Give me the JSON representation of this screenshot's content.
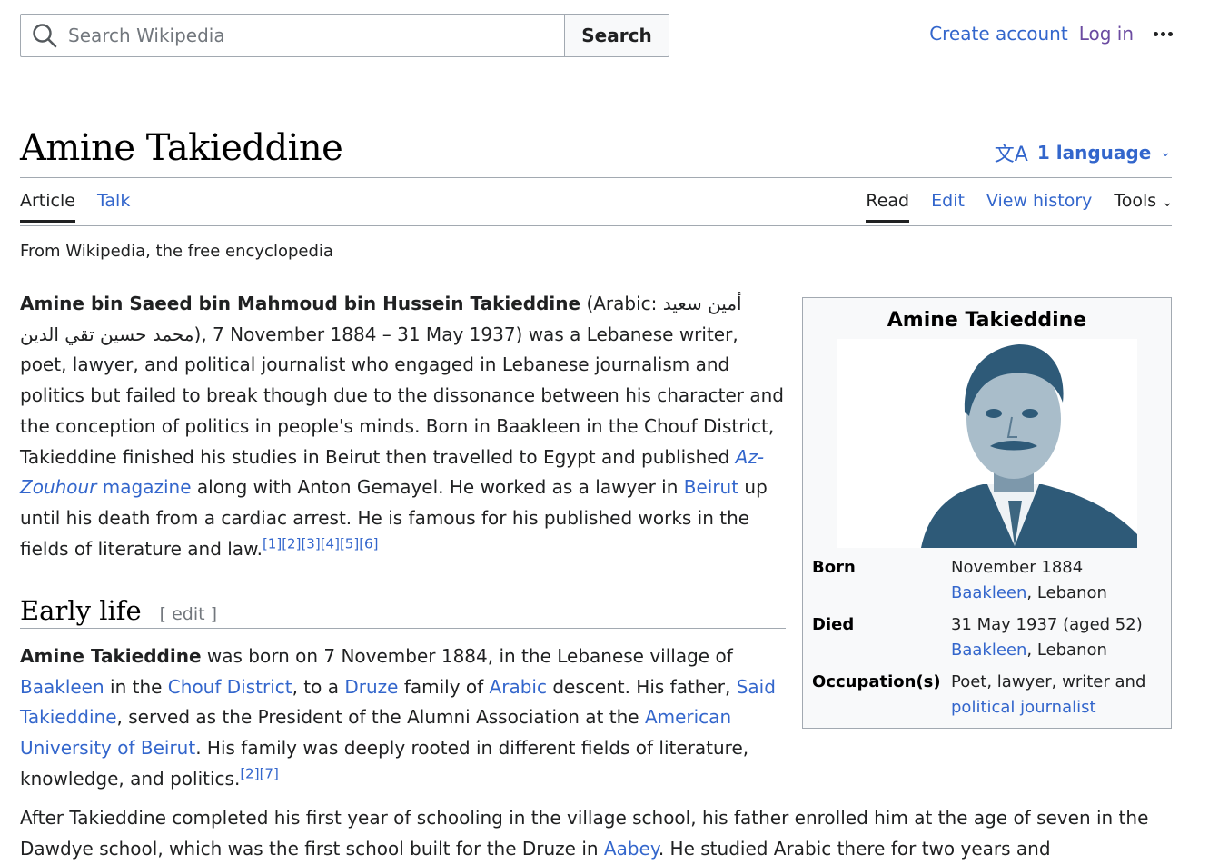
{
  "search": {
    "placeholder": "Search Wikipedia",
    "button": "Search"
  },
  "user_links": {
    "create_account": "Create account",
    "log_in": "Log in"
  },
  "page": {
    "title": "Amine Takieddine",
    "language_button": "1 language",
    "tagline": "From Wikipedia, the free encyclopedia"
  },
  "tabs": {
    "left": [
      "Article",
      "Talk"
    ],
    "right": [
      "Read",
      "Edit",
      "View history",
      "Tools"
    ]
  },
  "intro": {
    "bold_name": "Amine bin Saeed bin Mahmoud bin Hussein Takieddine",
    "arabic_prefix": " (Arabic: ",
    "arabic_name": "أمين سعيد محمد حسين تقي الدين",
    "text1": "), 7 November 1884 – 31 May 1937) was a Lebanese writer, poet, lawyer, and political journalist who engaged in Lebanese journalism and politics but failed to break though due to the dissonance between his character and the conception of politics in people's minds. Born in Baakleen in the Chouf District, Takieddine finished his studies in Beirut then travelled to Egypt and published ",
    "link_azzouhour": "Az-Zouhour",
    "link_magazine": " magazine",
    "text2": " along with Anton Gemayel. He worked as a lawyer in ",
    "link_beirut": "Beirut",
    "text3": " up until his death from a cardiac arrest. He is famous for his published works in the fields of literature and law.",
    "refs": "[1][2][3][4][5][6]"
  },
  "early_life": {
    "heading": "Early life",
    "edit": "[ edit ]",
    "bold_name": "Amine Takieddine",
    "t1": " was born on 7 November 1884, in the Lebanese village of ",
    "l_baakleen": "Baakleen",
    "t2": " in the ",
    "l_chouf": "Chouf District",
    "t3": ", to a ",
    "l_druze": "Druze",
    "t4": " family of ",
    "l_arabic": "Arabic",
    "t5": " descent. His father, ",
    "l_said": "Said Takieddine",
    "t6": ", served as the President of the Alumni Association at the ",
    "l_aub": "American University of Beirut",
    "t7": ". His family was deeply rooted in different fields of literature, knowledge, and politics.",
    "refs": "[2][7]"
  },
  "later": {
    "t1": "After Takieddine completed his first year of schooling in the village school, his father enrolled him at the age of seven in the Dawdye school, which was the first school built for the Druze in ",
    "l_aabey": "Aabey",
    "t2": ". He studied Arabic there for two years and"
  },
  "infobox": {
    "title": "Amine Takieddine",
    "rows": [
      {
        "label": "Born",
        "line1": "November 1884",
        "link": "Baakleen",
        "rest": ", Lebanon"
      },
      {
        "label": "Died",
        "line1": "31 May 1937 (aged 52)",
        "link": "Baakleen",
        "rest": ", Lebanon"
      },
      {
        "label": "Occupation(s)",
        "line1": "Poet, lawyer, writer and",
        "link": "political journalist",
        "rest": ""
      }
    ]
  },
  "colors": {
    "link": "#3366cc",
    "visited": "#6b4ba1",
    "border": "#a2a9b1",
    "portrait": "#2e5a78"
  }
}
